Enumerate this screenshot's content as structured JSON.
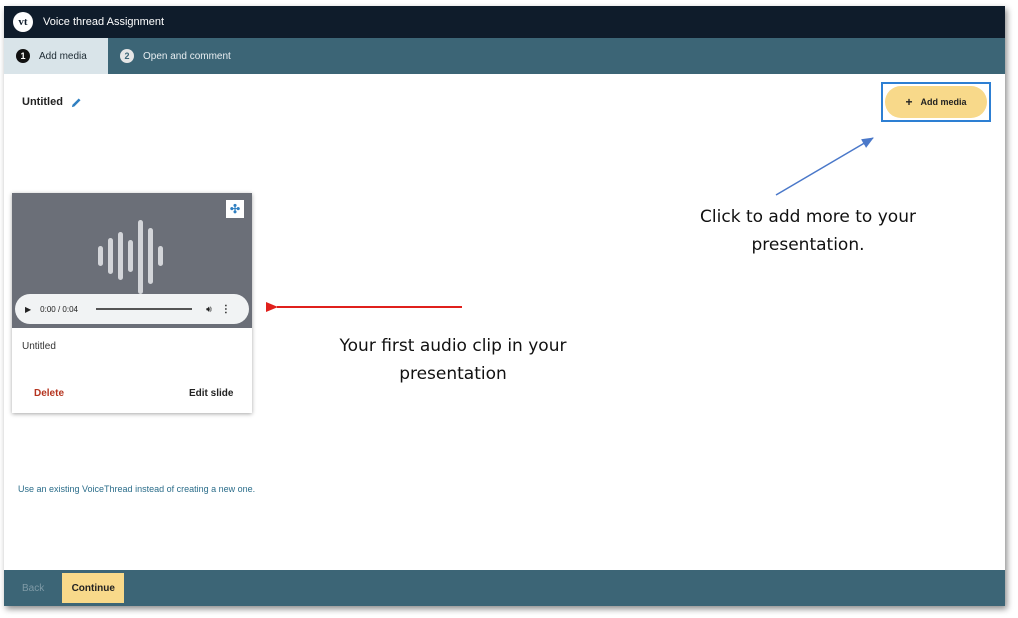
{
  "window": {
    "logo_text": "vt",
    "title": "Voice thread Assignment"
  },
  "steps": [
    {
      "number": "1",
      "label": "Add media",
      "active": true
    },
    {
      "number": "2",
      "label": "Open and comment",
      "active": false
    }
  ],
  "document": {
    "title": "Untitled"
  },
  "toolbar": {
    "add_media_label": "Add media"
  },
  "media_card": {
    "player_time": "0:00 / 0:04",
    "title": "Untitled",
    "delete_label": "Delete",
    "edit_label": "Edit slide"
  },
  "existing_link": "Use an existing VoiceThread instead of creating a new one.",
  "footer": {
    "back_label": "Back",
    "continue_label": "Continue"
  },
  "annotations": {
    "add_more_line1": "Click to add more to your",
    "add_more_line2": "presentation.",
    "first_clip_line1": "Your first audio clip in your",
    "first_clip_line2": "presentation"
  },
  "colors": {
    "titlebar": "#0f1c2b",
    "steps_bar": "#3c6576",
    "accent_yellow": "#f8d98a",
    "delete_red": "#b5341f",
    "link_blue": "#2b6d8a",
    "highlight_blue": "#2d7fd3",
    "arrow_red": "#e0201c",
    "arrow_blue": "#4a78c9"
  },
  "icons": [
    "vt-logo-icon",
    "pencil-icon",
    "plus-icon",
    "move-icon",
    "waveform-icon",
    "play-icon",
    "volume-icon",
    "more-vertical-icon"
  ]
}
